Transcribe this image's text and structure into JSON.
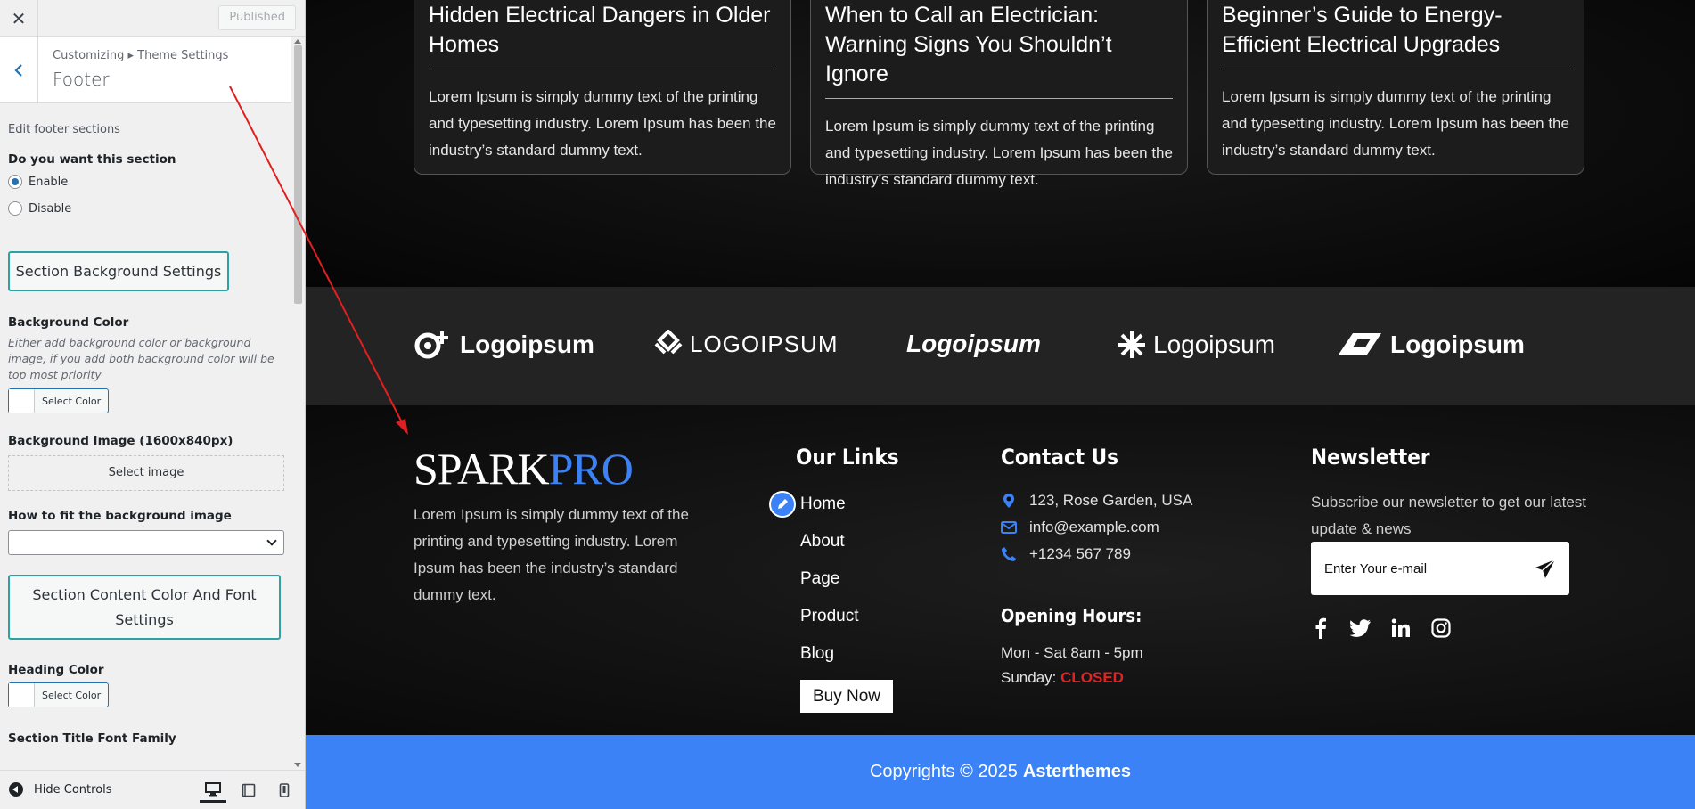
{
  "sidebar": {
    "published_label": "Published",
    "breadcrumb": "Customizing ▸ Theme Settings",
    "panel_title": "Footer",
    "edit_desc": "Edit footer sections",
    "section_question": "Do you want this section",
    "enable_label": "Enable",
    "disable_label": "Disable",
    "bg_settings_btn": "Section Background Settings",
    "bg_color_label": "Background Color",
    "bg_color_help": "Either add background color or background image, if you add both background color will be top most priority",
    "select_color_label": "Select Color",
    "bg_image_label": "Background Image (1600x840px)",
    "select_image_label": "Select image",
    "fit_label": "How to fit the background image",
    "fit_value": "",
    "content_settings_btn": "Section Content Color And Font Settings",
    "heading_color_label": "Heading Color",
    "font_family_label": "Section Title Font Family",
    "hide_controls": "Hide Controls"
  },
  "posts": [
    {
      "title": "Hidden Electrical Dangers in Older Homes",
      "excerpt": "Lorem Ipsum is simply dummy text of the printing and typesetting industry. Lorem Ipsum has been the industry’s standard dummy text."
    },
    {
      "title": "When to Call an Electrician: Warning Signs You Shouldn’t Ignore",
      "excerpt": "Lorem Ipsum is simply dummy text of the printing and typesetting industry. Lorem Ipsum has been the industry’s standard dummy text."
    },
    {
      "title": "Beginner’s Guide to Energy-Efficient Electrical Upgrades",
      "excerpt": "Lorem Ipsum is simply dummy text of the printing and typesetting industry. Lorem Ipsum has been the industry’s standard dummy text."
    }
  ],
  "logos": [
    "Logoipsum",
    "LOGOIPSUM",
    "Logoipsum",
    "Logoipsum",
    "Logoipsum"
  ],
  "footer": {
    "brand_part1": "SPARK",
    "brand_part2": "PRO",
    "about": "Lorem Ipsum is simply dummy text of the printing and typesetting industry. Lorem Ipsum has been the industry’s standard dummy text.",
    "links_title": "Our Links",
    "links": [
      "Home",
      "About",
      "Page",
      "Product",
      "Blog"
    ],
    "buy_now": "Buy Now",
    "contact_title": "Contact Us",
    "address": "123, Rose Garden, USA",
    "email": "info@example.com",
    "phone": "+1234 567 789",
    "hours_title": "Opening Hours:",
    "hours_weekday": "Mon - Sat 8am - 5pm",
    "hours_sunday_label": "Sunday:",
    "hours_sunday_value": "CLOSED",
    "newsletter_title": "Newsletter",
    "newsletter_desc": "Subscribe our newsletter to get our latest update & news",
    "newsletter_placeholder": "Enter Your e-mail",
    "copyright_text": "Copyrights © 2025",
    "copyright_brand": "Asterthemes"
  },
  "colors": {
    "accent": "#3b82f6",
    "closed": "#e02424",
    "annotation_arrow": "#e02020"
  }
}
